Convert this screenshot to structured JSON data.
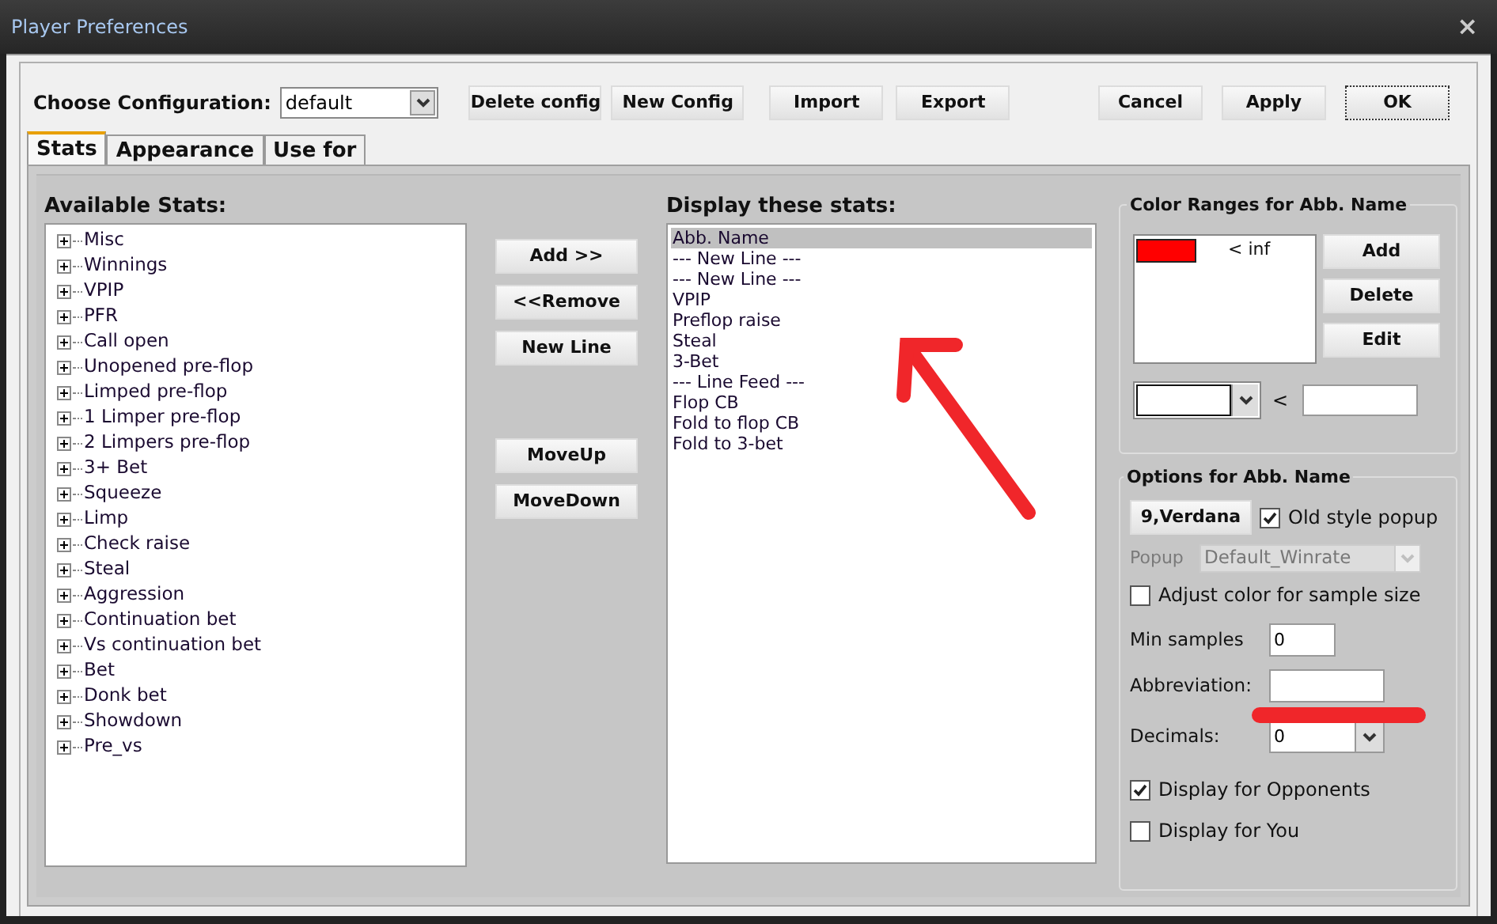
{
  "window": {
    "title": "Player Preferences",
    "close": "×"
  },
  "toolbar": {
    "config_label": "Choose Configuration:",
    "config_value": "default",
    "buttons": [
      "Delete config",
      "New Config",
      "Import",
      "Export"
    ],
    "dialog_buttons": [
      {
        "label": "Cancel",
        "default": false
      },
      {
        "label": "Apply",
        "default": false
      },
      {
        "label": "OK",
        "default": true
      }
    ]
  },
  "tabs": [
    {
      "label": "Stats",
      "selected": true
    },
    {
      "label": "Appearance",
      "selected": false
    },
    {
      "label": "Use for",
      "selected": false
    }
  ],
  "available": {
    "title": "Available Stats:",
    "items": [
      {
        "label": "Misc",
        "expanded": false
      },
      {
        "label": "Winnings",
        "expanded": false
      },
      {
        "label": "VPIP",
        "expanded": false
      },
      {
        "label": "PFR",
        "expanded": false
      },
      {
        "label": "Call open",
        "expanded": false
      },
      {
        "label": "Unopened pre-flop",
        "expanded": false
      },
      {
        "label": "Limped pre-flop",
        "expanded": false
      },
      {
        "label": "1 Limper pre-flop",
        "expanded": false
      },
      {
        "label": "2 Limpers pre-flop",
        "expanded": false
      },
      {
        "label": "3+ Bet",
        "expanded": false
      },
      {
        "label": "Squeeze",
        "expanded": false
      },
      {
        "label": "Limp",
        "expanded": false
      },
      {
        "label": "Check raise",
        "expanded": false
      },
      {
        "label": "Steal",
        "expanded": false
      },
      {
        "label": "Aggression",
        "expanded": false
      },
      {
        "label": "Continuation bet",
        "expanded": false
      },
      {
        "label": "Vs continuation bet",
        "expanded": false
      },
      {
        "label": "Bet",
        "expanded": false
      },
      {
        "label": "Donk bet",
        "expanded": false
      },
      {
        "label": "Showdown",
        "expanded": false
      },
      {
        "label": "Pre_vs",
        "expanded": false
      }
    ]
  },
  "actions": [
    [
      "Add >>",
      "<<Remove",
      "New Line"
    ],
    [
      "MoveUp",
      "MoveDown"
    ]
  ],
  "display": {
    "title": "Display these stats:",
    "items": [
      {
        "label": "Abb. Name",
        "selected": true
      },
      {
        "label": "--- New Line ---",
        "selected": false
      },
      {
        "label": "--- New Line ---",
        "selected": false
      },
      {
        "label": "VPIP",
        "selected": false
      },
      {
        "label": "Preflop raise",
        "selected": false
      },
      {
        "label": "Steal",
        "selected": false
      },
      {
        "label": "3-Bet",
        "selected": false
      },
      {
        "label": "--- Line Feed ---",
        "selected": false
      },
      {
        "label": "Flop CB",
        "selected": false
      },
      {
        "label": "Fold to flop CB",
        "selected": false
      },
      {
        "label": "Fold to 3-bet",
        "selected": false
      }
    ]
  },
  "color_ranges": {
    "title": "Color Ranges for Abb. Name",
    "ranges": [
      {
        "color": "#ff0000",
        "label": "< inf"
      }
    ],
    "buttons": [
      "Add",
      "Delete",
      "Edit"
    ],
    "compare": "<"
  },
  "options": {
    "title": "Options for Abb. Name",
    "font_button": "9,Verdana",
    "old_style_popup": {
      "label": "Old style popup",
      "checked": true
    },
    "popup": {
      "label": "Popup",
      "value": "Default_Winrate",
      "disabled": true
    },
    "adjust_color": {
      "label": "Adjust color for sample size",
      "checked": false
    },
    "min_samples": {
      "label": "Min samples",
      "value": "0"
    },
    "abbreviation": {
      "label": "Abbreviation:"
    },
    "decimals": {
      "label": "Decimals:",
      "value": "0"
    },
    "display_opponents": {
      "label": "Display for Opponents",
      "checked": true
    },
    "display_you": {
      "label": "Display for You",
      "checked": false
    }
  }
}
